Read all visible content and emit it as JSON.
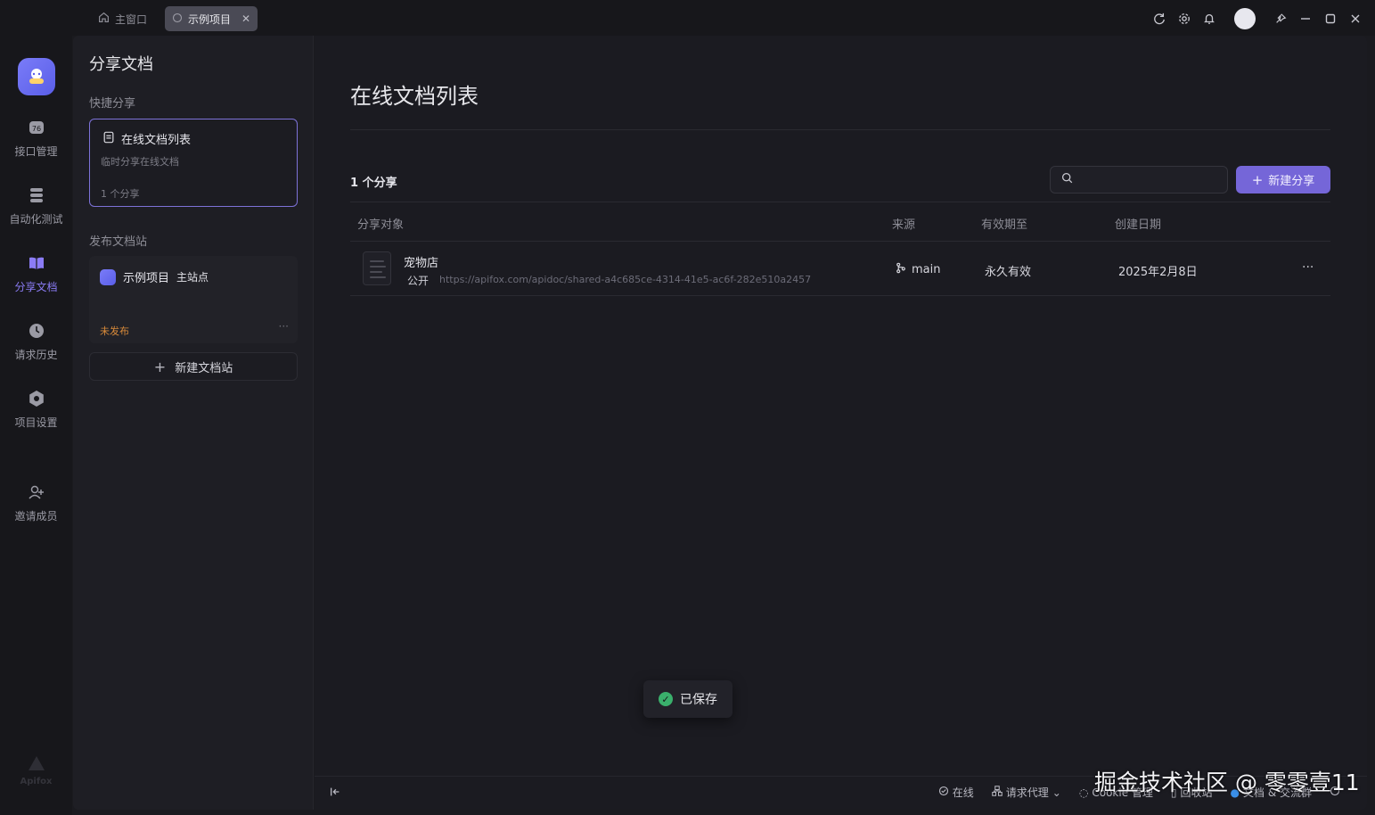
{
  "window": {
    "tabs": [
      {
        "label": "主窗口",
        "icon": "home-icon"
      },
      {
        "label": "示例项目",
        "icon": "project-icon",
        "active": true
      }
    ],
    "toolbar_icons": [
      "refresh-icon",
      "gear-icon",
      "bell-icon",
      "avatar",
      "pin-icon",
      "minimize-icon",
      "maximize-icon",
      "close-icon"
    ]
  },
  "nav": {
    "items": [
      {
        "label": "接口管理",
        "icon": "api-icon"
      },
      {
        "label": "自动化测试",
        "icon": "test-icon"
      },
      {
        "label": "分享文档",
        "icon": "book-icon",
        "active": true
      },
      {
        "label": "请求历史",
        "icon": "clock-icon"
      },
      {
        "label": "项目设置",
        "icon": "settings-icon"
      },
      {
        "label": "邀请成员",
        "icon": "invite-icon"
      }
    ],
    "footer": "Apifox"
  },
  "sidepanel": {
    "title": "分享文档",
    "quick_share_label": "快捷分享",
    "quick_card": {
      "title": "在线文档列表",
      "subtitle": "临时分享在线文档",
      "count": "1 个分享"
    },
    "publish_label": "发布文档站",
    "site_card": {
      "name": "示例项目",
      "tag": "主站点",
      "status": "未发布",
      "more": "···"
    },
    "new_site": "新建文档站"
  },
  "main": {
    "title": "在线文档列表",
    "count": "1 个分享",
    "search_placeholder": "",
    "new_share": "新建分享",
    "columns": [
      "分享对象",
      "来源",
      "有效期至",
      "创建日期"
    ],
    "rows": [
      {
        "name": "宠物店",
        "visibility": "公开",
        "url": "https://apifox.com/apidoc/shared-a4c685ce-4314-41e5-ac6f-282e510a2457",
        "source": "main",
        "expires": "永久有效",
        "created": "2025年2月8日",
        "more": "···"
      }
    ]
  },
  "toast": {
    "text": "已保存"
  },
  "statusbar": {
    "items": [
      "在线",
      "请求代理",
      "Cookie 管理",
      "回收站",
      "文档 & 交流群"
    ]
  },
  "watermark": "掘金技术社区 @ 零零壹11",
  "colors": {
    "accent": "#7566d8",
    "active_nav": "#8b7cf6",
    "unpublished": "#d88a3a",
    "success": "#3ab06c"
  }
}
